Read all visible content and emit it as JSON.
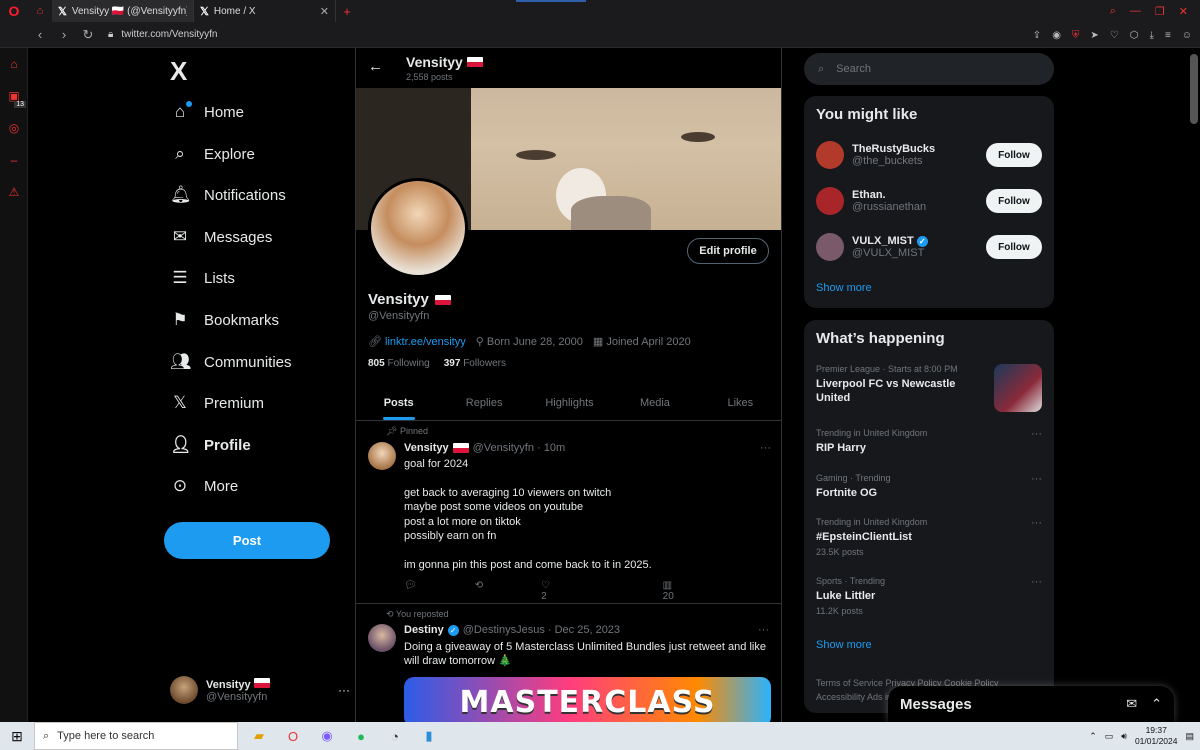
{
  "browser": {
    "tabs": [
      {
        "label": "Vensityy 🇵🇱 (@Vensityyfn) / X",
        "active": true
      },
      {
        "label": "Home / X",
        "active": false
      }
    ],
    "url": "twitter.com/Vensityyfn",
    "sidebar_badge": "13"
  },
  "nav": {
    "logo": "X",
    "items": [
      {
        "label": "Home",
        "icon": "home-icon"
      },
      {
        "label": "Explore",
        "icon": "search-icon"
      },
      {
        "label": "Notifications",
        "icon": "bell-icon"
      },
      {
        "label": "Messages",
        "icon": "mail-icon"
      },
      {
        "label": "Lists",
        "icon": "list-icon"
      },
      {
        "label": "Bookmarks",
        "icon": "bookmark-icon"
      },
      {
        "label": "Communities",
        "icon": "people-icon"
      },
      {
        "label": "Premium",
        "icon": "x-icon"
      },
      {
        "label": "Profile",
        "icon": "person-icon"
      },
      {
        "label": "More",
        "icon": "more-circle-icon"
      }
    ],
    "post_label": "Post",
    "account": {
      "name": "Vensityy",
      "handle": "@Vensityyfn",
      "more": "···"
    }
  },
  "profile": {
    "name": "Vensityy",
    "posts_count": "2,558 posts",
    "handle": "@Vensityyfn",
    "edit_label": "Edit profile",
    "link": "linktr.ee/vensityy",
    "born": "Born June 28, 2000",
    "joined": "Joined April 2020",
    "following_count": "805",
    "following_label": "Following",
    "followers_count": "397",
    "followers_label": "Followers",
    "tabs": [
      "Posts",
      "Replies",
      "Highlights",
      "Media",
      "Likes"
    ]
  },
  "tweets": [
    {
      "context": "Pinned",
      "name": "Vensityy",
      "handle": "@Vensityyfn · 10m",
      "text": "goal for 2024\n\nget back to averaging 10 viewers on twitch\nmaybe post some videos on youtube\npost a lot more on tiktok\npossibly earn on fn\n\nim gonna pin this post and come back to it in 2025.",
      "likes": "2",
      "views": "20"
    },
    {
      "context": "You reposted",
      "name": "Destiny",
      "handle": "@DestinysJesus · Dec 25, 2023",
      "text": "Doing a giveaway of 5 Masterclass Unlimited Bundles just retweet and like will draw tomorrow 🎄",
      "image_text": "MASTERCLASS"
    }
  ],
  "right": {
    "search_placeholder": "Search",
    "might_like_title": "You might like",
    "suggestions": [
      {
        "name": "TheRustyBucks",
        "handle": "@the_buckets",
        "verified": false,
        "follow": "Follow",
        "color": "#b23a2a"
      },
      {
        "name": "Ethan.",
        "handle": "@russianethan",
        "verified": false,
        "follow": "Follow",
        "color": "#a8262a"
      },
      {
        "name": "VULX_MIST",
        "handle": "@VULX_MIST",
        "verified": true,
        "follow": "Follow",
        "color": "#7a5a6a"
      }
    ],
    "show_more": "Show more",
    "happening_title": "What’s happening",
    "trends": [
      {
        "meta": "Premier League · Starts at 8:00 PM",
        "title": "Liverpool FC vs Newcastle United",
        "count": ""
      },
      {
        "meta": "Trending in United Kingdom",
        "title": "RIP Harry",
        "count": ""
      },
      {
        "meta": "Gaming · Trending",
        "title": "Fortnite OG",
        "count": ""
      },
      {
        "meta": "Trending in United Kingdom",
        "title": "#EpsteinClientList",
        "count": "23.5K posts"
      },
      {
        "meta": "Sports · Trending",
        "title": "Luke Littler",
        "count": "11.2K posts"
      }
    ],
    "footer": "Terms of Service  Privacy Policy  Cookie Policy  Accessibility  Ads info  More ···",
    "messages_title": "Messages"
  },
  "taskbar": {
    "search_placeholder": "Type here to search",
    "time": "19:37",
    "date": "01/01/2024"
  }
}
